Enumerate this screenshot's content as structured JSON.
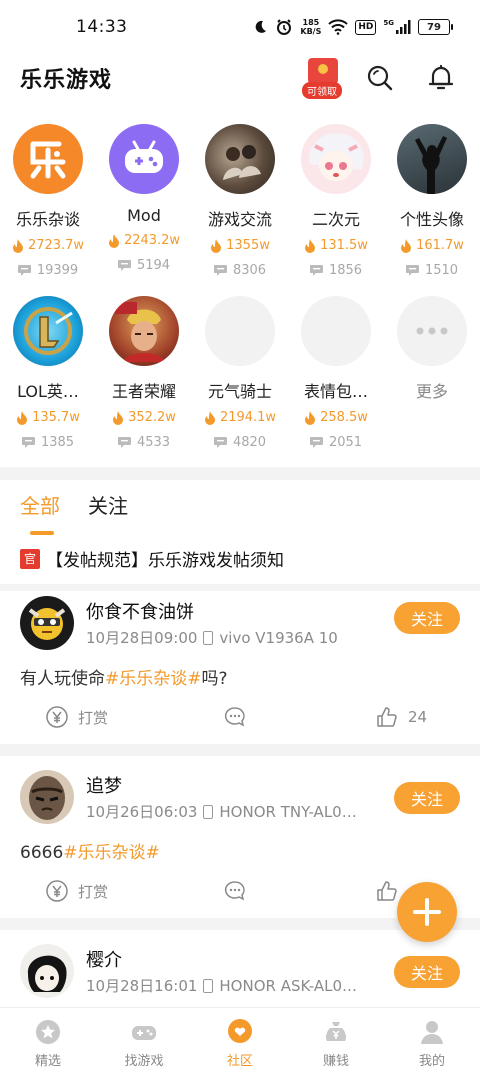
{
  "status_bar": {
    "time": "14:33",
    "net_speed_value": "185",
    "net_speed_unit": "KB/S",
    "hd": "HD",
    "signal": "5G",
    "battery": "79"
  },
  "header": {
    "title": "乐乐游戏",
    "gift_label": "可领取"
  },
  "categories": [
    {
      "name": "乐乐杂谈",
      "heat": "2723.7w",
      "posts": "19399"
    },
    {
      "name": "Mod",
      "heat": "2243.2w",
      "posts": "5194"
    },
    {
      "name": "游戏交流",
      "heat": "1355w",
      "posts": "8306"
    },
    {
      "name": "二次元",
      "heat": "131.5w",
      "posts": "1856"
    },
    {
      "name": "个性头像",
      "heat": "161.7w",
      "posts": "1510"
    },
    {
      "name": "LOL英…",
      "heat": "135.7w",
      "posts": "1385"
    },
    {
      "name": "王者荣耀",
      "heat": "352.2w",
      "posts": "4533"
    },
    {
      "name": "元气骑士",
      "heat": "2194.1w",
      "posts": "4820"
    },
    {
      "name": "表情包…",
      "heat": "258.5w",
      "posts": "2051"
    },
    {
      "name": "更多"
    }
  ],
  "tabs": [
    "全部",
    "关注"
  ],
  "notice": {
    "badge": "官",
    "text": "【发帖规范】乐乐游戏发帖须知"
  },
  "posts": [
    {
      "user": "你食不食油饼",
      "date": "10月28日09:00",
      "device": "vivo V1936A 10",
      "follow": "关注",
      "text_before": "有人玩使命",
      "topic": "#乐乐杂谈#",
      "text_after": "吗?",
      "reward": "打赏",
      "likes": "24"
    },
    {
      "user": "追梦",
      "date": "10月26日06:03",
      "device": "HONOR TNY-AL0…",
      "follow": "关注",
      "text_before": "6666",
      "topic": "#乐乐杂谈#",
      "text_after": "",
      "reward": "打赏",
      "likes": ""
    },
    {
      "user": "樱介",
      "date": "10月28日16:01",
      "device": "HONOR ASK-AL0…",
      "follow": "关注"
    }
  ],
  "bottom_nav": [
    "精选",
    "找游戏",
    "社区",
    "赚钱",
    "我的"
  ],
  "colors": {
    "accent": "#f39a2b",
    "red": "#e33b2e"
  }
}
